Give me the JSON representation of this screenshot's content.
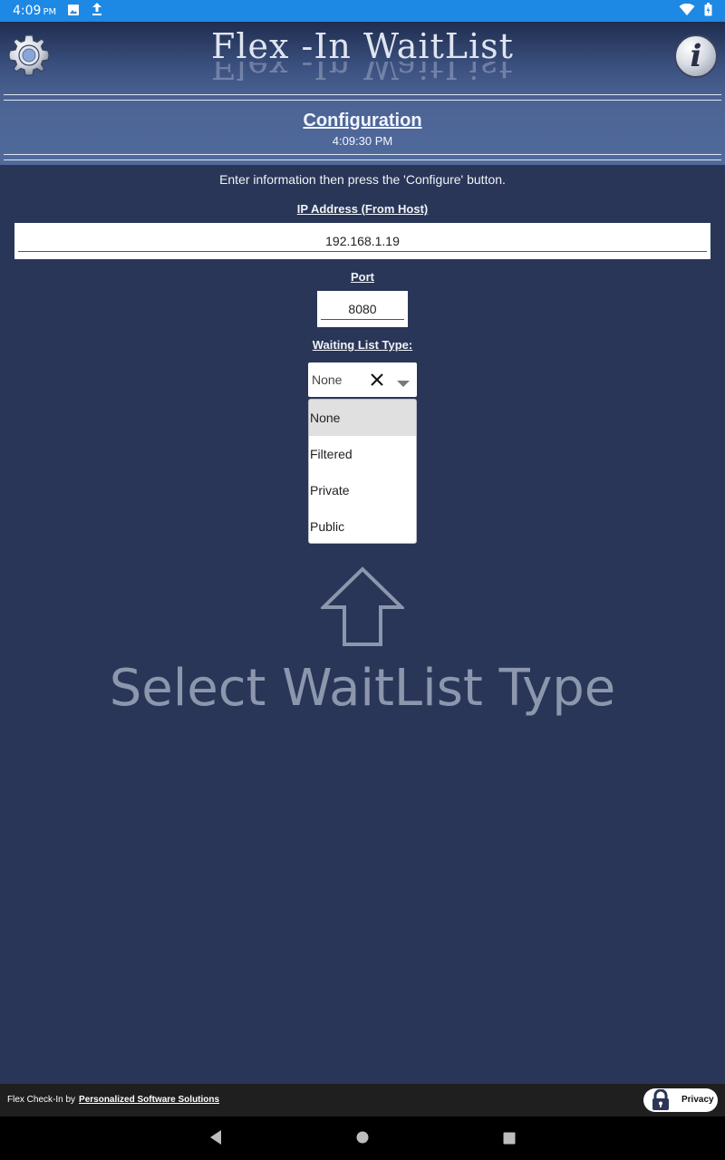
{
  "status_bar": {
    "time": "4:09",
    "period": "PM",
    "icons": [
      "image-icon",
      "upload-icon",
      "wifi-icon",
      "battery-icon"
    ]
  },
  "header": {
    "brand": "Flex -In WaitList",
    "title": "Configuration",
    "time": "4:09:30 PM",
    "settings_icon": "gear-icon",
    "info_icon": "info-icon",
    "info_glyph": "i"
  },
  "form": {
    "instruction": "Enter information then press the  'Configure' button.",
    "ip_label": "IP Address (From Host)",
    "ip_value": "192.168.1.19",
    "port_label": "Port",
    "port_value": "8080",
    "waitlist_label": "Waiting List Type:",
    "waitlist_selected": "None",
    "waitlist_options": [
      "None",
      "Filtered",
      "Private",
      "Public"
    ]
  },
  "hint": {
    "text": "Select WaitList Type",
    "icon": "up-arrow-icon"
  },
  "footer": {
    "credit_prefix": "Flex Check-In by",
    "credit_link": "Personalized Software Solutions",
    "privacy_label": "Privacy"
  },
  "colors": {
    "background": "#293657",
    "status_bar": "#1e88e5",
    "hint_text": "#8c97ae"
  }
}
